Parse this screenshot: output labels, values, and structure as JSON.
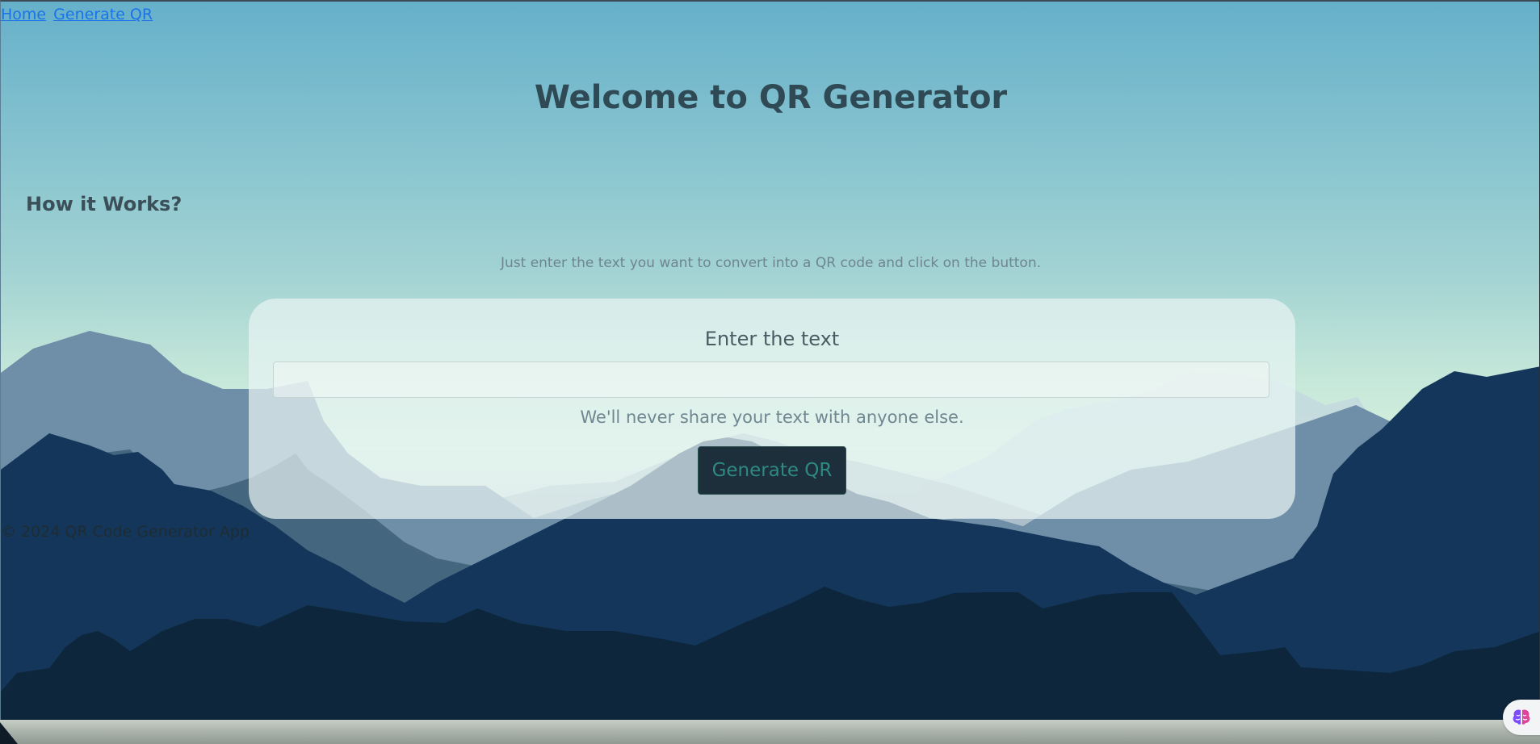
{
  "nav": {
    "links": [
      {
        "label": "Home"
      },
      {
        "label": "Generate QR"
      }
    ]
  },
  "main": {
    "title": "Welcome to QR Generator",
    "section_title": "How it Works?",
    "instructions": "Just enter the text you want to convert into a QR code and click on the button."
  },
  "form": {
    "label": "Enter the text",
    "input_value": "",
    "input_placeholder": "",
    "help_text": "We'll never share your text with anyone else.",
    "button_label": "Generate QR"
  },
  "footer": {
    "text": "© 2024 QR Code Generator App"
  },
  "assistant": {
    "icon": "brain-icon"
  },
  "colors": {
    "link": "#1a73e8",
    "title": "#2f4a55",
    "button_bg": "#1d2f3b",
    "button_text": "#2e8a80"
  }
}
